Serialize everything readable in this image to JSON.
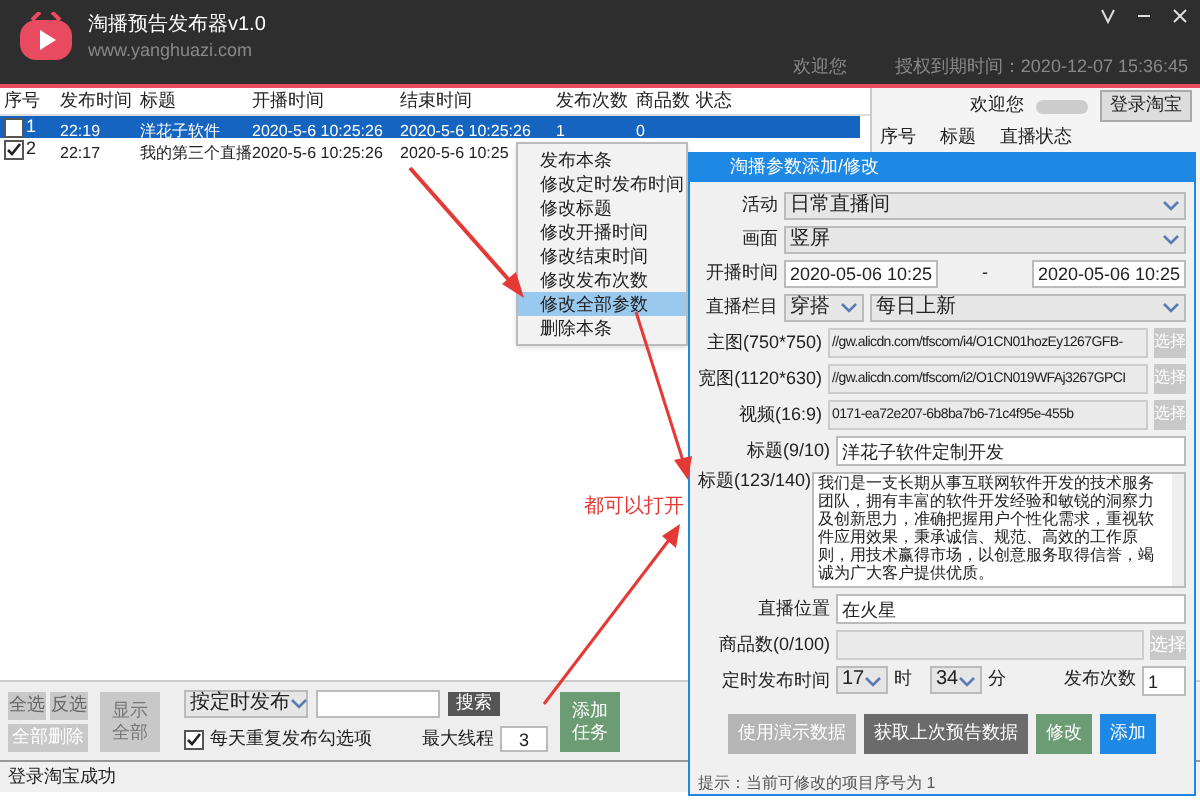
{
  "header": {
    "title": "淘播预告发布器v1.0",
    "subtitle": "www.yanghuazi.com",
    "welcome": "欢迎您",
    "expiry": "授权到期时间：2020-12-07 15:36:45"
  },
  "table": {
    "columns": [
      "序号",
      "发布时间",
      "标题",
      "开播时间",
      "结束时间",
      "发布次数",
      "商品数",
      "状态"
    ],
    "rows": [
      {
        "checked": false,
        "selected": true,
        "cells": [
          "1",
          "22:19",
          "洋花子软件",
          "2020-5-6 10:25:26",
          "2020-5-6 10:25:26",
          "1",
          "0",
          ""
        ]
      },
      {
        "checked": true,
        "selected": false,
        "cells": [
          "2",
          "22:17",
          "我的第三个直播",
          "2020-5-6 10:25:26",
          "2020-5-6 10:25",
          "",
          "",
          ""
        ]
      }
    ]
  },
  "right_panel": {
    "welcome": "欢迎您",
    "login_button": "登录淘宝",
    "columns": [
      "序号",
      "标题",
      "直播状态"
    ]
  },
  "context_menu": [
    {
      "label": "发布本条",
      "selected": false
    },
    {
      "label": "修改定时发布时间",
      "selected": false
    },
    {
      "label": "修改标题",
      "selected": false
    },
    {
      "label": "修改开播时间",
      "selected": false
    },
    {
      "label": "修改结束时间",
      "selected": false
    },
    {
      "label": "修改发布次数",
      "selected": false
    },
    {
      "label": "修改全部参数",
      "selected": true
    },
    {
      "label": "删除本条",
      "selected": false
    }
  ],
  "annotation": "都可以打开",
  "dialog": {
    "title": "淘播参数添加/修改",
    "activity": {
      "label": "活动",
      "value": "日常直播间"
    },
    "screen": {
      "label": "画面",
      "value": "竖屏"
    },
    "start_time": {
      "label": "开播时间",
      "from": "2020-05-06 10:25",
      "separator": "-",
      "to": "2020-05-06 10:25"
    },
    "column": {
      "label": "直播栏目",
      "value1": "穿搭",
      "value2": "每日上新"
    },
    "files": [
      {
        "label": "主图(750*750)",
        "value": "//gw.alicdn.com/tfscom/i4/O1CN01hozEy1267GFB-",
        "button": "选择"
      },
      {
        "label": "宽图(1120*630)",
        "value": "//gw.alicdn.com/tfscom/i2/O1CN019WFAj3267GPCI",
        "button": "选择"
      },
      {
        "label": "视频(16:9)",
        "value": "0171-ea72e207-6b8ba7b6-71c4f95e-455b",
        "button": "选择"
      }
    ],
    "title_field": {
      "label": "标题(9/10)",
      "value": "洋花子软件定制开发"
    },
    "description": {
      "label": "标题(123/140)",
      "value": "我们是一支长期从事互联网软件开发的技术服务团队，拥有丰富的软件开发经验和敏锐的洞察力及创新思力，准确把握用户个性化需求，重视软件应用效果，秉承诚信、规范、高效的工作原则，用技术赢得市场，以创意服务取得信誉，竭诚为广大客户提供优质。"
    },
    "location": {
      "label": "直播位置",
      "value": "在火星"
    },
    "products": {
      "label": "商品数(0/100)",
      "button": "选择"
    },
    "schedule": {
      "label": "定时发布时间",
      "hour": "17",
      "hour_unit": "时",
      "minute": "34",
      "minute_unit": "分",
      "count_label": "发布次数",
      "count": "1"
    },
    "buttons": [
      {
        "label": "使用演示数据",
        "kind": "muted"
      },
      {
        "label": "获取上次预告数据",
        "kind": "dark"
      },
      {
        "label": "修改",
        "kind": "green"
      },
      {
        "label": "添加",
        "kind": "blue"
      }
    ],
    "hint": "提示：当前可修改的项目序号为 1"
  },
  "bottom": {
    "select_all": "全选",
    "invert": "反选",
    "clear_all": "全部删除",
    "show_all": "显示全部",
    "filter": "按定时发布",
    "search": "搜索",
    "add_task": "添加任务",
    "repeat": {
      "label": "每天重复发布勾选项",
      "checked": true
    },
    "threads_label": "最大线程",
    "threads": "3"
  },
  "status_bar": "登录淘宝成功"
}
